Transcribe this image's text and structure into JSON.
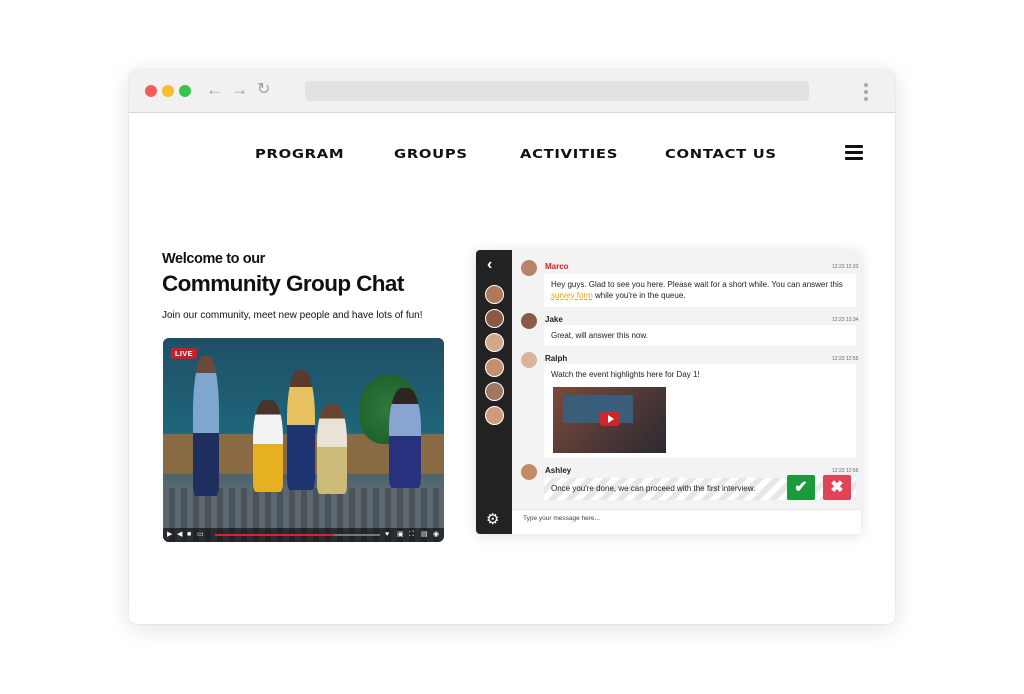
{
  "nav": {
    "items": [
      {
        "label": "PROGRAM"
      },
      {
        "label": "GROUPS"
      },
      {
        "label": "ACTIVITIES"
      },
      {
        "label": "CONTACT US"
      }
    ]
  },
  "hero": {
    "welcome_line": "Welcome to our",
    "title": "Community Group Chat",
    "subtitle": "Join our community, meet new people and have lots of fun!"
  },
  "video": {
    "live_label": "LIVE",
    "progress": 0.72
  },
  "chat": {
    "messages": [
      {
        "name": "Marco",
        "time": "12:23 12:33",
        "text_before": "Hey guys. Glad to see you here. Please wait for a short while. You can answer this ",
        "link_text": "survey form",
        "text_after": " while you're in the queue."
      },
      {
        "name": "Jake",
        "time": "12:23 12:34",
        "text": "Great, will answer this now."
      },
      {
        "name": "Ralph",
        "time": "12:23 12:55",
        "text": "Watch the event highlights here for Day 1!"
      },
      {
        "name": "Ashley",
        "time": "12:23 12:56",
        "text": "Once you're done, we can proceed with the first interview."
      }
    ],
    "input_placeholder": "Type your message here..."
  },
  "colors": {
    "accent_red": "#d8202b",
    "link_orange": "#e8a217",
    "accept_green": "#1a9a3a",
    "reject_red": "#e04456"
  }
}
